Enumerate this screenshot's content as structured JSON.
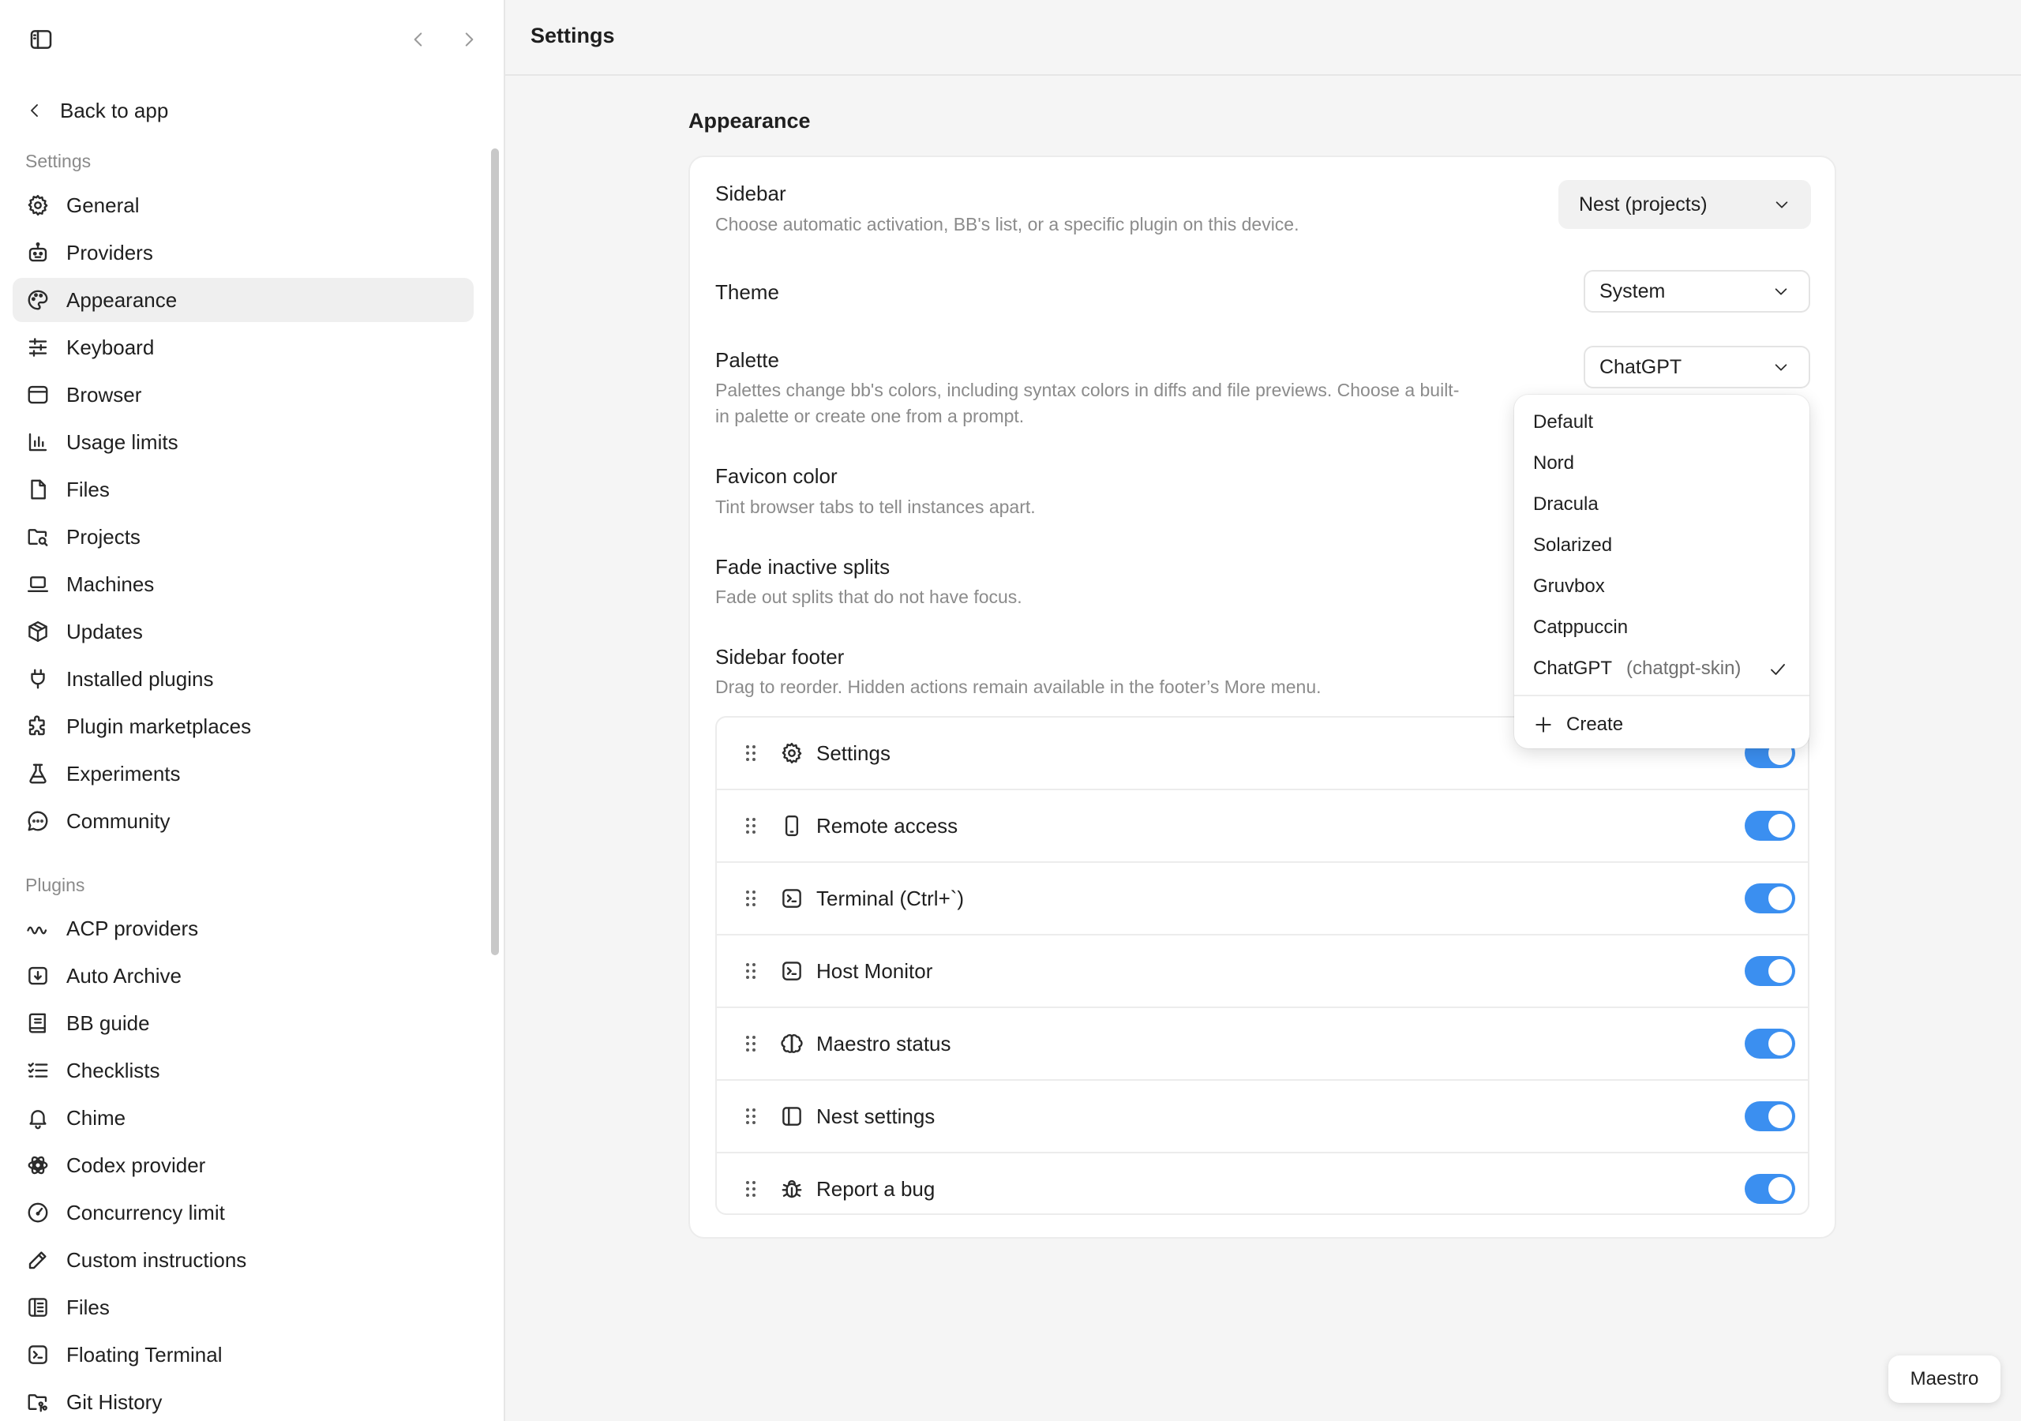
{
  "sidebar": {
    "back_label": "Back to app",
    "settings_section": "Settings",
    "settings_items": [
      {
        "label": "General",
        "icon": "gear-icon"
      },
      {
        "label": "Providers",
        "icon": "bot-icon"
      },
      {
        "label": "Appearance",
        "icon": "palette-icon",
        "active": true
      },
      {
        "label": "Keyboard",
        "icon": "sliders-icon"
      },
      {
        "label": "Browser",
        "icon": "browser-icon"
      },
      {
        "label": "Usage limits",
        "icon": "bar-chart-icon"
      },
      {
        "label": "Files",
        "icon": "file-icon"
      },
      {
        "label": "Projects",
        "icon": "folder-search-icon"
      },
      {
        "label": "Machines",
        "icon": "laptop-icon"
      },
      {
        "label": "Updates",
        "icon": "package-icon"
      },
      {
        "label": "Installed plugins",
        "icon": "plug-icon"
      },
      {
        "label": "Plugin marketplaces",
        "icon": "puzzle-icon"
      },
      {
        "label": "Experiments",
        "icon": "flask-icon"
      },
      {
        "label": "Community",
        "icon": "chat-icon"
      }
    ],
    "plugins_section": "Plugins",
    "plugin_items": [
      {
        "label": "ACP providers",
        "icon": "wave-icon"
      },
      {
        "label": "Auto Archive",
        "icon": "archive-icon"
      },
      {
        "label": "BB guide",
        "icon": "book-icon"
      },
      {
        "label": "Checklists",
        "icon": "checklist-icon"
      },
      {
        "label": "Chime",
        "icon": "bell-icon"
      },
      {
        "label": "Codex provider",
        "icon": "openai-icon"
      },
      {
        "label": "Concurrency limit",
        "icon": "gauge-icon"
      },
      {
        "label": "Custom instructions",
        "icon": "pencil-icon"
      },
      {
        "label": "Files",
        "icon": "file-tree-icon"
      },
      {
        "label": "Floating Terminal",
        "icon": "terminal-icon"
      },
      {
        "label": "Git History",
        "icon": "folder-git-icon"
      }
    ]
  },
  "header": {
    "title": "Settings"
  },
  "main": {
    "section_title": "Appearance",
    "sidebar_setting": {
      "title": "Sidebar",
      "description": "Choose automatic activation, BB's list, or a specific plugin on this device.",
      "value": "Nest (projects)"
    },
    "theme_setting": {
      "title": "Theme",
      "value": "System"
    },
    "palette_setting": {
      "title": "Palette",
      "description_line1": "Palettes change bb's colors, including syntax colors in diffs and file previews. Choose a built-",
      "description_line2": "in palette or create one from a prompt.",
      "value": "ChatGPT"
    },
    "favicon_setting": {
      "title": "Favicon color",
      "description": "Tint browser tabs to tell instances apart."
    },
    "fade_setting": {
      "title": "Fade inactive splits",
      "description": "Fade out splits that do not have focus."
    },
    "footer_setting": {
      "title": "Sidebar footer",
      "description": "Drag to reorder. Hidden actions remain available in the footer’s More menu.",
      "items": [
        {
          "label": "Settings",
          "icon": "gear-icon",
          "enabled": true
        },
        {
          "label": "Remote access",
          "icon": "phone-icon",
          "enabled": true
        },
        {
          "label": "Terminal (Ctrl+`)",
          "icon": "terminal-icon",
          "enabled": true
        },
        {
          "label": "Host Monitor",
          "icon": "terminal-icon",
          "enabled": true
        },
        {
          "label": "Maestro status",
          "icon": "brain-icon",
          "enabled": true
        },
        {
          "label": "Nest settings",
          "icon": "sidebar-panel-icon",
          "enabled": true
        },
        {
          "label": "Report a bug",
          "icon": "bug-icon",
          "enabled": true
        }
      ]
    }
  },
  "palette_dropdown": {
    "options": [
      "Default",
      "Nord",
      "Dracula",
      "Solarized",
      "Gruvbox",
      "Catppuccin",
      "ChatGPT"
    ],
    "selected_slug": "(chatgpt-skin)",
    "create_label": "Create"
  },
  "bottom_chip": {
    "label": "Maestro"
  },
  "colors": {
    "accent": "#3b8ff0",
    "active_nav": "#efefef",
    "page_bg": "#f5f5f5"
  }
}
